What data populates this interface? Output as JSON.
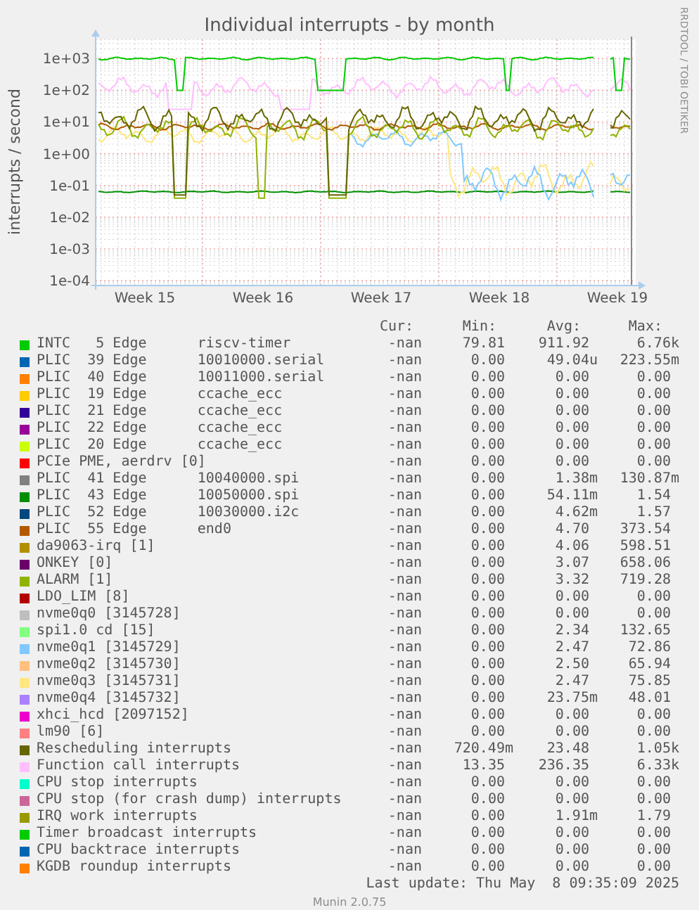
{
  "graph": {
    "title": "Individual interrupts - by month",
    "y_axis_label": "interrupts / second",
    "side_text": "RRDTOOL / TOBI OETIKER",
    "y_ticks": [
      "1e+03",
      "1e+02",
      "1e+01",
      "1e+00",
      "1e-01",
      "1e-02",
      "1e-03",
      "1e-04"
    ],
    "x_ticks": [
      "Week 15",
      "Week 16",
      "Week 17",
      "Week 18",
      "Week 19"
    ]
  },
  "legend": {
    "columns": [
      "Cur:",
      "Min:",
      "Avg:",
      "Max:"
    ],
    "rows": [
      {
        "label": "INTC   5 Edge      riscv-timer",
        "color": "#00cc00",
        "cur": "-nan",
        "min": "79.81",
        "avg": "911.92",
        "max": "6.76k"
      },
      {
        "label": "PLIC  39 Edge      10010000.serial",
        "color": "#0066b3",
        "cur": "-nan",
        "min": "0.00",
        "avg": "49.04u",
        "max": "223.55m"
      },
      {
        "label": "PLIC  40 Edge      10011000.serial",
        "color": "#ff8000",
        "cur": "-nan",
        "min": "0.00",
        "avg": "0.00",
        "max": "0.00"
      },
      {
        "label": "PLIC  19 Edge      ccache_ecc",
        "color": "#ffcc00",
        "cur": "-nan",
        "min": "0.00",
        "avg": "0.00",
        "max": "0.00"
      },
      {
        "label": "PLIC  21 Edge      ccache_ecc",
        "color": "#330099",
        "cur": "-nan",
        "min": "0.00",
        "avg": "0.00",
        "max": "0.00"
      },
      {
        "label": "PLIC  22 Edge      ccache_ecc",
        "color": "#990099",
        "cur": "-nan",
        "min": "0.00",
        "avg": "0.00",
        "max": "0.00"
      },
      {
        "label": "PLIC  20 Edge      ccache_ecc",
        "color": "#ccff00",
        "cur": "-nan",
        "min": "0.00",
        "avg": "0.00",
        "max": "0.00"
      },
      {
        "label": "PCIe PME, aerdrv [0]",
        "color": "#ff0000",
        "cur": "-nan",
        "min": "0.00",
        "avg": "0.00",
        "max": "0.00"
      },
      {
        "label": "PLIC  41 Edge      10040000.spi",
        "color": "#808080",
        "cur": "-nan",
        "min": "0.00",
        "avg": "1.38m",
        "max": "130.87m"
      },
      {
        "label": "PLIC  43 Edge      10050000.spi",
        "color": "#008f00",
        "cur": "-nan",
        "min": "0.00",
        "avg": "54.11m",
        "max": "1.54"
      },
      {
        "label": "PLIC  52 Edge      10030000.i2c",
        "color": "#00487d",
        "cur": "-nan",
        "min": "0.00",
        "avg": "4.62m",
        "max": "1.57"
      },
      {
        "label": "PLIC  55 Edge      end0",
        "color": "#b35a00",
        "cur": "-nan",
        "min": "0.00",
        "avg": "4.70",
        "max": "373.54"
      },
      {
        "label": "da9063-irq [1]",
        "color": "#b38f00",
        "cur": "-nan",
        "min": "0.00",
        "avg": "4.06",
        "max": "598.51"
      },
      {
        "label": "ONKEY [0]",
        "color": "#6b006b",
        "cur": "-nan",
        "min": "0.00",
        "avg": "3.07",
        "max": "658.06"
      },
      {
        "label": "ALARM [1]",
        "color": "#8fb300",
        "cur": "-nan",
        "min": "0.00",
        "avg": "3.32",
        "max": "719.28"
      },
      {
        "label": "LDO_LIM [8]",
        "color": "#b30000",
        "cur": "-nan",
        "min": "0.00",
        "avg": "0.00",
        "max": "0.00"
      },
      {
        "label": "nvme0q0 [3145728]",
        "color": "#bebebe",
        "cur": "-nan",
        "min": "0.00",
        "avg": "0.00",
        "max": "0.00"
      },
      {
        "label": "spi1.0 cd [15]",
        "color": "#80ff80",
        "cur": "-nan",
        "min": "0.00",
        "avg": "2.34",
        "max": "132.65"
      },
      {
        "label": "nvme0q1 [3145729]",
        "color": "#80c9ff",
        "cur": "-nan",
        "min": "0.00",
        "avg": "2.47",
        "max": "72.86"
      },
      {
        "label": "nvme0q2 [3145730]",
        "color": "#ffc080",
        "cur": "-nan",
        "min": "0.00",
        "avg": "2.50",
        "max": "65.94"
      },
      {
        "label": "nvme0q3 [3145731]",
        "color": "#ffe680",
        "cur": "-nan",
        "min": "0.00",
        "avg": "2.47",
        "max": "75.85"
      },
      {
        "label": "nvme0q4 [3145732]",
        "color": "#aa80ff",
        "cur": "-nan",
        "min": "0.00",
        "avg": "23.75m",
        "max": "48.01"
      },
      {
        "label": "xhci_hcd [2097152]",
        "color": "#ee00cc",
        "cur": "-nan",
        "min": "0.00",
        "avg": "0.00",
        "max": "0.00"
      },
      {
        "label": "lm90 [6]",
        "color": "#ff8080",
        "cur": "-nan",
        "min": "0.00",
        "avg": "0.00",
        "max": "0.00"
      },
      {
        "label": "Rescheduling interrupts",
        "color": "#666600",
        "cur": "-nan",
        "min": "720.49m",
        "avg": "23.48",
        "max": "1.05k"
      },
      {
        "label": "Function call interrupts",
        "color": "#ffbfff",
        "cur": "-nan",
        "min": "13.35",
        "avg": "236.35",
        "max": "6.33k"
      },
      {
        "label": "CPU stop interrupts",
        "color": "#00ffcc",
        "cur": "-nan",
        "min": "0.00",
        "avg": "0.00",
        "max": "0.00"
      },
      {
        "label": "CPU stop (for crash dump) interrupts",
        "color": "#cc6699",
        "cur": "-nan",
        "min": "0.00",
        "avg": "0.00",
        "max": "0.00"
      },
      {
        "label": "IRQ work interrupts",
        "color": "#999900",
        "cur": "-nan",
        "min": "0.00",
        "avg": "1.91m",
        "max": "1.79"
      },
      {
        "label": "Timer broadcast interrupts",
        "color": "#00cc00",
        "cur": "-nan",
        "min": "0.00",
        "avg": "0.00",
        "max": "0.00"
      },
      {
        "label": "CPU backtrace interrupts",
        "color": "#0066b3",
        "cur": "-nan",
        "min": "0.00",
        "avg": "0.00",
        "max": "0.00"
      },
      {
        "label": "KGDB roundup interrupts",
        "color": "#ff8000",
        "cur": "-nan",
        "min": "0.00",
        "avg": "0.00",
        "max": "0.00"
      }
    ]
  },
  "last_update": "Last update: Thu May  8 09:35:09 2025",
  "footer": "Munin 2.0.75"
}
